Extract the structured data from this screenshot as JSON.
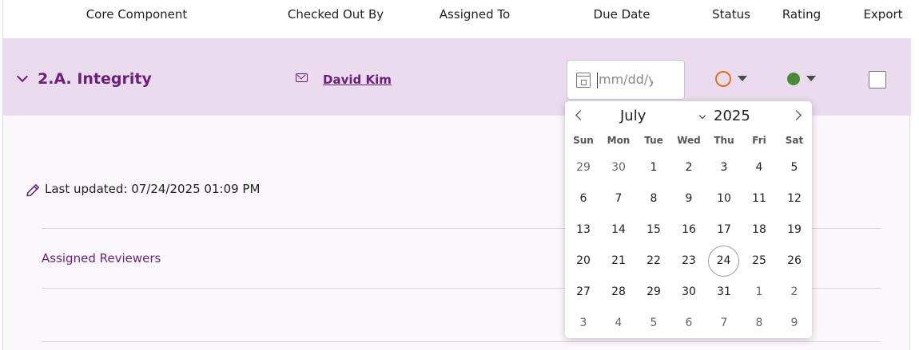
{
  "columns": {
    "core_component": "Core Component",
    "checked_out_by": "Checked Out By",
    "assigned_to": "Assigned To",
    "due_date": "Due Date",
    "status": "Status",
    "rating": "Rating",
    "export": "Export"
  },
  "row": {
    "title": "2.A. Integrity",
    "checked_out_by": "David Kim",
    "due_date_placeholder": "mm/dd/yy",
    "status_color": "#e06f1e",
    "rating_color": "#4a8a35"
  },
  "details": {
    "last_updated": "Last updated: 07/24/2025 01:09 PM",
    "assigned_reviewers": "Assigned Reviewers"
  },
  "calendar": {
    "month": "July",
    "year": "2025",
    "weekdays": [
      "Sun",
      "Mon",
      "Tue",
      "Wed",
      "Thu",
      "Fri",
      "Sat"
    ],
    "days": [
      [
        "29",
        "30",
        "1",
        "2",
        "3",
        "4",
        "5"
      ],
      [
        "6",
        "7",
        "8",
        "9",
        "10",
        "11",
        "12"
      ],
      [
        "13",
        "14",
        "15",
        "16",
        "17",
        "18",
        "19"
      ],
      [
        "20",
        "21",
        "22",
        "23",
        "24",
        "25",
        "26"
      ],
      [
        "27",
        "28",
        "29",
        "30",
        "31",
        "1",
        "2"
      ],
      [
        "3",
        "4",
        "5",
        "6",
        "7",
        "8",
        "9"
      ]
    ],
    "today": "24"
  },
  "colors": {
    "accent": "#6a1f7a",
    "row_background": "#eadcee"
  }
}
